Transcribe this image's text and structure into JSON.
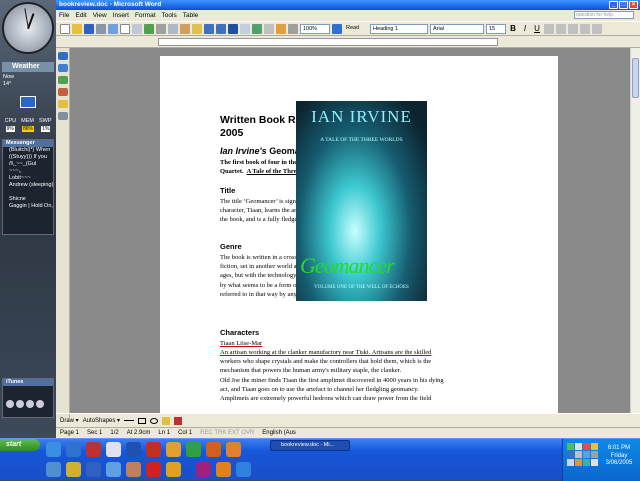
{
  "window": {
    "title": "bookreview.doc - Microsoft Word"
  },
  "menu": [
    "File",
    "Edit",
    "View",
    "Insert",
    "Format",
    "Tools",
    "Table"
  ],
  "help_box": {
    "placeholder": "question for help"
  },
  "toolbar": {
    "zoom": "100%",
    "read": "Read",
    "style": "Heading 1",
    "font": "Arial",
    "size": "15"
  },
  "sidebar": {
    "weather_title": "Weather",
    "weather_lines": [
      "Now",
      "14°"
    ],
    "meters": [
      "CPU",
      "MEM",
      "SWP"
    ],
    "meter_values": [
      "9%",
      "86%",
      "1%"
    ],
    "messenger_title": "Messenger",
    "contacts": [
      "(Bluitchi)*) When",
      "((Stuyy))) If you",
      "/l\\_~~_(Gul",
      "~~~,,",
      "Lobit~~~",
      "Andrew (sleeping)",
      " ",
      "Shicne",
      "Gaggin | Hold On, I"
    ],
    "itunes_title": "iTunes"
  },
  "document": {
    "title_line1": "Written Book Review. Term 2",
    "title_line2": "2005",
    "book_author": "Ian Irvine's",
    "book_name": "Geomancer",
    "subtitle_line1": "The first book of four in the Well Of Echoes",
    "subtitle_line2a": "Quartet.",
    "subtitle_line2b": "A Tale of the Three Worlds.",
    "title_heading": "Title",
    "title_para": "The title ‘Geomancer’ is significant because the main character, Tiaan, learns the arts of geomancing throughout the book, and is a fully fledged geomancer by the end.",
    "genre_heading": "Genre",
    "genre_para": "The book is written in a cross between fantasies and science fiction, set in another world at a stage similar to our medieval ages, but with the technology of motorized vehicles powered by what seems to be a form of magic, although is not referred to in that way by any of the characters.",
    "characters_heading": "Characters",
    "char_name": "Tiaan Liise-Mar",
    "char_lines": [
      "An artisan working at the clanker manufactory near Tiski.   Artisans are the skilled",
      "workers who shape crystals and make the controllers that hold them, which is the",
      "mechanism that powers the human army's military staple, the clanker.",
      "Old Joe the miner finds Tiaan the first amplimet discovered in 4000 years in his dying",
      "act, and Tiaan goes on to use the artefact to channel her fledgling geomancy.",
      "Amplimets are extremely powerful hedrons which can draw power from the field"
    ]
  },
  "cover": {
    "author": "IAN IRVINE",
    "subtitle": "A TALE OF THE THREE WORLDS",
    "title": "Geomancer",
    "volume": "VOLUME ONE OF THE WELL OF ECHOES"
  },
  "drawbar": {
    "draw": "Draw ▾",
    "autoshapes": "AutoShapes ▾"
  },
  "status": {
    "page": "Page 1",
    "sec": "Sec 1",
    "of": "1/2",
    "at": "At 2.9cm",
    "ln": "Ln 1",
    "col": "Col 1",
    "flags": "REC  TRK  EXT  OVR",
    "lang": "English (Aus"
  },
  "taskbar": {
    "start": "start",
    "task": "bookreview.doc - Mi...",
    "time": "6:01 PM",
    "day": "Friday",
    "date": "3/06/2005"
  }
}
